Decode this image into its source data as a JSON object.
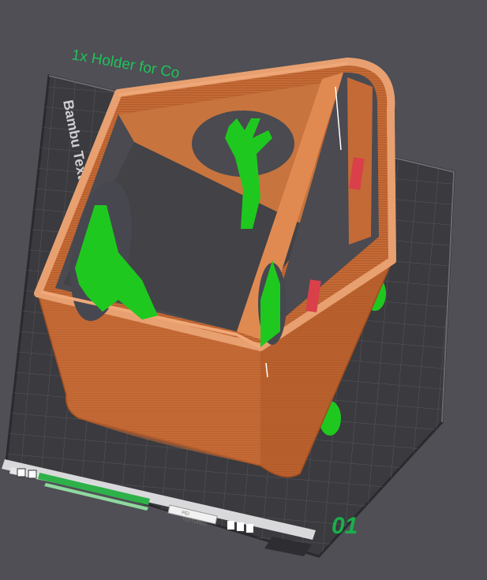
{
  "scene": {
    "object_label": "1x Holder for Co",
    "plate_name": "Bambu Textured PEI Plate",
    "plate_number": "01",
    "plate_status_text_1": "PEI",
    "plate_status_text_2": "TEXTURED"
  },
  "colors": {
    "background": "#4f4f55",
    "bed": "#3a3a3e",
    "bed_grid": "#55555b",
    "object_orange": "#c46a36",
    "object_orange_light": "#e59a62",
    "support_green": "#1fc81f",
    "label_green": "#19b04a"
  },
  "icons": [
    "lock-icon",
    "settings-icon",
    "bed-icon",
    "filament-icon"
  ]
}
